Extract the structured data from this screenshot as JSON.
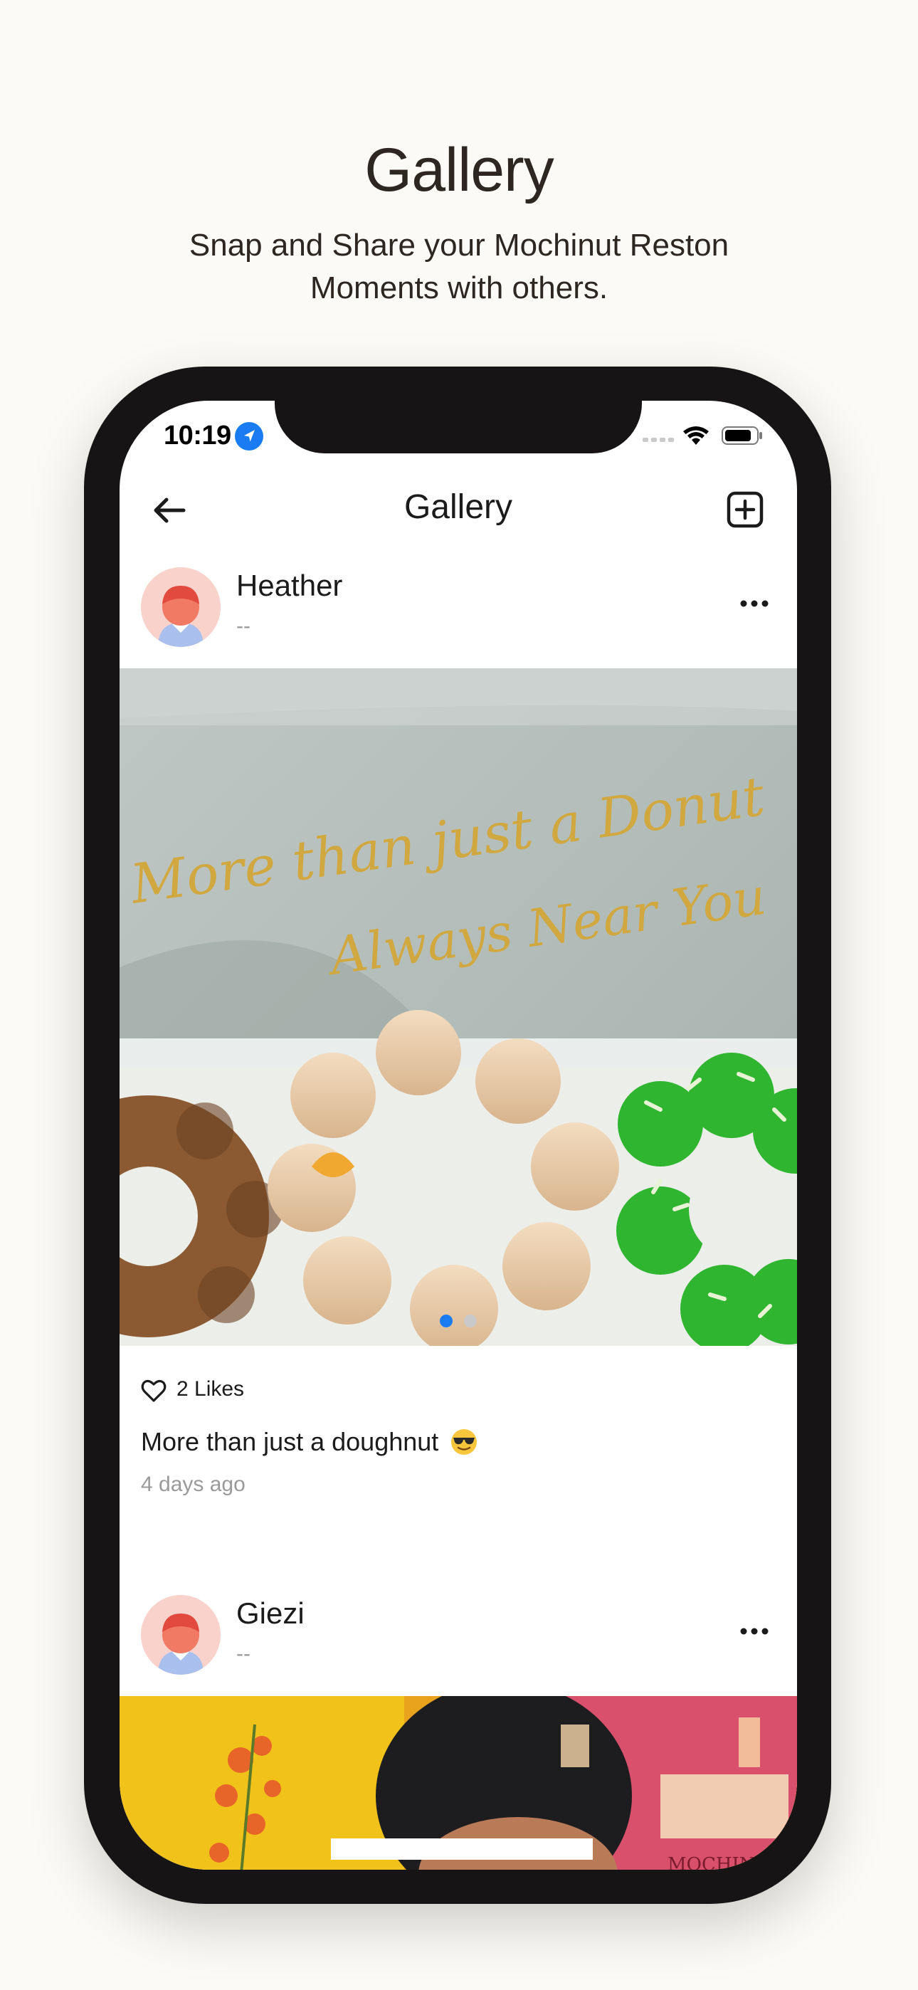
{
  "promo": {
    "title": "Gallery",
    "subtitle": "Snap and Share your Mochinut Reston Moments with others."
  },
  "status_bar": {
    "time": "10:19",
    "icons": [
      "location-arrow-icon",
      "signal-icon",
      "wifi-icon",
      "battery-icon"
    ]
  },
  "nav": {
    "title": "Gallery",
    "back_icon": "arrow-left-icon",
    "add_icon": "plus-square-icon"
  },
  "posts": [
    {
      "username": "Heather",
      "subtitle": "--",
      "image_text": [
        "More than just a Donut",
        "Always Near You"
      ],
      "carousel": {
        "count": 2,
        "active": 0
      },
      "likes": "2 Likes",
      "caption": "More than just a doughnut",
      "caption_emoji": "sunglasses-emoji",
      "time_ago": "4 days ago"
    },
    {
      "username": "Giezi",
      "subtitle": "--",
      "image_sign": "MOCHINUT"
    }
  ],
  "colors": {
    "background": "#fcfaf6",
    "phone_frame": "#161415",
    "accent_blue": "#1a7cf2",
    "text_primary": "#1b1b1b",
    "text_secondary": "#9a9a9a",
    "avatar_bg": "#f9d2cc"
  }
}
